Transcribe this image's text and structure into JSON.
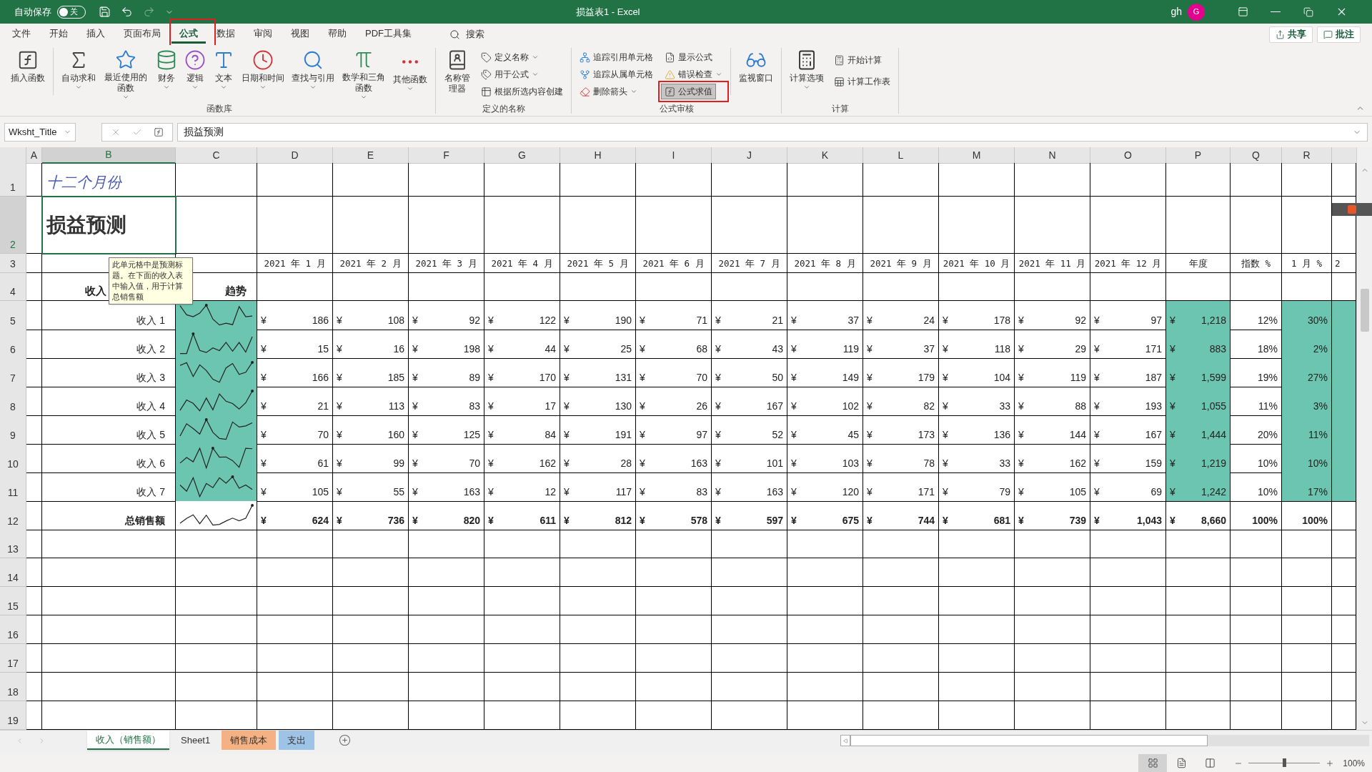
{
  "title_bar": {
    "autosave": {
      "label": "自动保存",
      "on": false,
      "state_label": "关"
    },
    "redo": {
      "disabled": true
    },
    "title": "损益表1 - Excel",
    "user": "gh",
    "avatar": "G"
  },
  "menu_tabs": [
    {
      "label": "文件",
      "selected": false,
      "annotated": false
    },
    {
      "label": "开始",
      "selected": false,
      "annotated": false
    },
    {
      "label": "插入",
      "selected": false,
      "annotated": false
    },
    {
      "label": "页面布局",
      "selected": false,
      "annotated": false
    },
    {
      "label": "公式",
      "selected": true,
      "annotated": true
    },
    {
      "label": "数据",
      "selected": false,
      "annotated": false
    },
    {
      "label": "审阅",
      "selected": false,
      "annotated": false
    },
    {
      "label": "视图",
      "selected": false,
      "annotated": false
    },
    {
      "label": "帮助",
      "selected": false,
      "annotated": false
    },
    {
      "label": "PDF工具集",
      "selected": false,
      "annotated": false
    }
  ],
  "search": {
    "label": "搜索"
  },
  "share_button": "共享",
  "comments_button": "批注",
  "ribbon": {
    "groups": [
      {
        "label": "函数库",
        "kind": "functions",
        "buttons": [
          {
            "label": "插入函数",
            "dropdown": false
          },
          {
            "label": "自动求和",
            "dropdown": true
          },
          {
            "label": "最近使用的函数",
            "dropdown": true
          },
          {
            "label": "财务",
            "dropdown": true
          },
          {
            "label": "逻辑",
            "dropdown": true
          },
          {
            "label": "文本",
            "dropdown": true
          },
          {
            "label": "日期和时间",
            "dropdown": true
          },
          {
            "label": "查找与引用",
            "dropdown": true
          },
          {
            "label": "数学和三角函数",
            "dropdown": true
          },
          {
            "label": "其他函数",
            "dropdown": true
          }
        ]
      },
      {
        "label": "定义的名称",
        "kind": "names",
        "large": {
          "label": "名称管理器",
          "dropdown": false
        },
        "small": [
          {
            "label": "定义名称",
            "dropdown": true
          },
          {
            "label": "用于公式",
            "dropdown": true
          },
          {
            "label": "根据所选内容创建",
            "dropdown": false
          }
        ]
      },
      {
        "label": "公式审核",
        "kind": "audit",
        "small": [
          {
            "label": "追踪引用单元格",
            "dropdown": false,
            "selected": false,
            "annotated": false
          },
          {
            "label": "追踪从属单元格",
            "dropdown": false,
            "selected": false,
            "annotated": false
          },
          {
            "label": "删除箭头",
            "dropdown": true,
            "selected": false,
            "annotated": false
          },
          {
            "label": "显示公式",
            "dropdown": false,
            "selected": false,
            "annotated": false
          },
          {
            "label": "错误检查",
            "dropdown": true,
            "selected": false,
            "annotated": false
          },
          {
            "label": "公式求值",
            "dropdown": false,
            "selected": true,
            "annotated": true
          }
        ],
        "large": {
          "label": "监视窗口",
          "dropdown": false
        }
      },
      {
        "label": "计算",
        "kind": "calc",
        "large": {
          "label": "计算选项",
          "dropdown": true
        },
        "small": [
          {
            "label": "开始计算",
            "dropdown": false
          },
          {
            "label": "计算工作表",
            "dropdown": false
          }
        ]
      }
    ]
  },
  "formula_bar": {
    "name_box": "Wksht_Title",
    "formula": "损益预测"
  },
  "sheet": {
    "columns": [
      {
        "label": "A",
        "selected": false
      },
      {
        "label": "B",
        "selected": true
      },
      {
        "label": "C",
        "selected": false
      },
      {
        "label": "D",
        "selected": false
      },
      {
        "label": "E",
        "selected": false
      },
      {
        "label": "F",
        "selected": false
      },
      {
        "label": "G",
        "selected": false
      },
      {
        "label": "H",
        "selected": false
      },
      {
        "label": "I",
        "selected": false
      },
      {
        "label": "J",
        "selected": false
      },
      {
        "label": "K",
        "selected": false
      },
      {
        "label": "L",
        "selected": false
      },
      {
        "label": "M",
        "selected": false
      },
      {
        "label": "N",
        "selected": false
      },
      {
        "label": "O",
        "selected": false
      },
      {
        "label": "P",
        "selected": false
      },
      {
        "label": "Q",
        "selected": false
      },
      {
        "label": "R",
        "selected": false
      }
    ],
    "row_numbers": [
      {
        "label": "1",
        "selected": false
      },
      {
        "label": "2",
        "selected": true
      },
      {
        "label": "3",
        "selected": false
      },
      {
        "label": "4",
        "selected": false
      },
      {
        "label": "5",
        "selected": false
      },
      {
        "label": "6",
        "selected": false
      },
      {
        "label": "7",
        "selected": false
      },
      {
        "label": "8",
        "selected": false
      },
      {
        "label": "9",
        "selected": false
      },
      {
        "label": "10",
        "selected": false
      },
      {
        "label": "11",
        "selected": false
      },
      {
        "label": "12",
        "selected": false
      },
      {
        "label": "13",
        "selected": false
      },
      {
        "label": "14",
        "selected": false
      },
      {
        "label": "15",
        "selected": false
      },
      {
        "label": "16",
        "selected": false
      },
      {
        "label": "17",
        "selected": false
      },
      {
        "label": "18",
        "selected": false
      },
      {
        "label": "19",
        "selected": false
      }
    ],
    "month_label": "十二个月份",
    "title_cell": {
      "text": "损益预测",
      "selected": true
    },
    "header_row": [
      "2021 年 1 月",
      "2021 年 2 月",
      "2021 年 3 月",
      "2021 年 4 月",
      "2021 年 5 月",
      "2021 年 6 月",
      "2021 年 7 月",
      "2021 年 8 月",
      "2021 年 9 月",
      "2021 年 10 月",
      "2021 年 11 月",
      "2021 年 12 月",
      "年度",
      "指数 %",
      "1 月 %",
      "2"
    ],
    "section_label": "收入",
    "trend_label": "趋势",
    "rows": [
      {
        "kind": "income",
        "label": "收入 1",
        "highlighted": true,
        "values": [
          {
            "symbol": "¥",
            "amount": "186"
          },
          {
            "symbol": "¥",
            "amount": "108"
          },
          {
            "symbol": "¥",
            "amount": "92"
          },
          {
            "symbol": "¥",
            "amount": "122"
          },
          {
            "symbol": "¥",
            "amount": "190"
          },
          {
            "symbol": "¥",
            "amount": "71"
          },
          {
            "symbol": "¥",
            "amount": "21"
          },
          {
            "symbol": "¥",
            "amount": "37"
          },
          {
            "symbol": "¥",
            "amount": "24"
          },
          {
            "symbol": "¥",
            "amount": "178"
          },
          {
            "symbol": "¥",
            "amount": "92"
          },
          {
            "symbol": "¥",
            "amount": "97"
          }
        ],
        "annual": {
          "symbol": "¥",
          "amount": "1,218"
        },
        "index": "12%",
        "share": "30%"
      },
      {
        "kind": "income",
        "label": "收入 2",
        "highlighted": true,
        "values": [
          {
            "symbol": "¥",
            "amount": "15"
          },
          {
            "symbol": "¥",
            "amount": "16"
          },
          {
            "symbol": "¥",
            "amount": "198"
          },
          {
            "symbol": "¥",
            "amount": "44"
          },
          {
            "symbol": "¥",
            "amount": "25"
          },
          {
            "symbol": "¥",
            "amount": "68"
          },
          {
            "symbol": "¥",
            "amount": "43"
          },
          {
            "symbol": "¥",
            "amount": "119"
          },
          {
            "symbol": "¥",
            "amount": "37"
          },
          {
            "symbol": "¥",
            "amount": "118"
          },
          {
            "symbol": "¥",
            "amount": "29"
          },
          {
            "symbol": "¥",
            "amount": "171"
          }
        ],
        "annual": {
          "symbol": "¥",
          "amount": "883"
        },
        "index": "18%",
        "share": "2%"
      },
      {
        "kind": "income",
        "label": "收入 3",
        "highlighted": true,
        "values": [
          {
            "symbol": "¥",
            "amount": "166"
          },
          {
            "symbol": "¥",
            "amount": "185"
          },
          {
            "symbol": "¥",
            "amount": "89"
          },
          {
            "symbol": "¥",
            "amount": "170"
          },
          {
            "symbol": "¥",
            "amount": "131"
          },
          {
            "symbol": "¥",
            "amount": "70"
          },
          {
            "symbol": "¥",
            "amount": "50"
          },
          {
            "symbol": "¥",
            "amount": "149"
          },
          {
            "symbol": "¥",
            "amount": "179"
          },
          {
            "symbol": "¥",
            "amount": "104"
          },
          {
            "symbol": "¥",
            "amount": "119"
          },
          {
            "symbol": "¥",
            "amount": "187"
          }
        ],
        "annual": {
          "symbol": "¥",
          "amount": "1,599"
        },
        "index": "19%",
        "share": "27%"
      },
      {
        "kind": "income",
        "label": "收入 4",
        "highlighted": true,
        "values": [
          {
            "symbol": "¥",
            "amount": "21"
          },
          {
            "symbol": "¥",
            "amount": "113"
          },
          {
            "symbol": "¥",
            "amount": "83"
          },
          {
            "symbol": "¥",
            "amount": "17"
          },
          {
            "symbol": "¥",
            "amount": "130"
          },
          {
            "symbol": "¥",
            "amount": "26"
          },
          {
            "symbol": "¥",
            "amount": "167"
          },
          {
            "symbol": "¥",
            "amount": "102"
          },
          {
            "symbol": "¥",
            "amount": "82"
          },
          {
            "symbol": "¥",
            "amount": "33"
          },
          {
            "symbol": "¥",
            "amount": "88"
          },
          {
            "symbol": "¥",
            "amount": "193"
          }
        ],
        "annual": {
          "symbol": "¥",
          "amount": "1,055"
        },
        "index": "11%",
        "share": "3%"
      },
      {
        "kind": "income",
        "label": "收入 5",
        "highlighted": true,
        "values": [
          {
            "symbol": "¥",
            "amount": "70"
          },
          {
            "symbol": "¥",
            "amount": "160"
          },
          {
            "symbol": "¥",
            "amount": "125"
          },
          {
            "symbol": "¥",
            "amount": "84"
          },
          {
            "symbol": "¥",
            "amount": "191"
          },
          {
            "symbol": "¥",
            "amount": "97"
          },
          {
            "symbol": "¥",
            "amount": "52"
          },
          {
            "symbol": "¥",
            "amount": "45"
          },
          {
            "symbol": "¥",
            "amount": "173"
          },
          {
            "symbol": "¥",
            "amount": "136"
          },
          {
            "symbol": "¥",
            "amount": "144"
          },
          {
            "symbol": "¥",
            "amount": "167"
          }
        ],
        "annual": {
          "symbol": "¥",
          "amount": "1,444"
        },
        "index": "20%",
        "share": "11%"
      },
      {
        "kind": "income",
        "label": "收入 6",
        "highlighted": true,
        "values": [
          {
            "symbol": "¥",
            "amount": "61"
          },
          {
            "symbol": "¥",
            "amount": "99"
          },
          {
            "symbol": "¥",
            "amount": "70"
          },
          {
            "symbol": "¥",
            "amount": "162"
          },
          {
            "symbol": "¥",
            "amount": "28"
          },
          {
            "symbol": "¥",
            "amount": "163"
          },
          {
            "symbol": "¥",
            "amount": "101"
          },
          {
            "symbol": "¥",
            "amount": "103"
          },
          {
            "symbol": "¥",
            "amount": "78"
          },
          {
            "symbol": "¥",
            "amount": "33"
          },
          {
            "symbol": "¥",
            "amount": "162"
          },
          {
            "symbol": "¥",
            "amount": "159"
          }
        ],
        "annual": {
          "symbol": "¥",
          "amount": "1,219"
        },
        "index": "10%",
        "share": "10%"
      },
      {
        "kind": "income",
        "label": "收入 7",
        "highlighted": true,
        "values": [
          {
            "symbol": "¥",
            "amount": "105"
          },
          {
            "symbol": "¥",
            "amount": "55"
          },
          {
            "symbol": "¥",
            "amount": "163"
          },
          {
            "symbol": "¥",
            "amount": "12"
          },
          {
            "symbol": "¥",
            "amount": "117"
          },
          {
            "symbol": "¥",
            "amount": "83"
          },
          {
            "symbol": "¥",
            "amount": "163"
          },
          {
            "symbol": "¥",
            "amount": "120"
          },
          {
            "symbol": "¥",
            "amount": "171"
          },
          {
            "symbol": "¥",
            "amount": "79"
          },
          {
            "symbol": "¥",
            "amount": "105"
          },
          {
            "symbol": "¥",
            "amount": "69"
          }
        ],
        "annual": {
          "symbol": "¥",
          "amount": "1,242"
        },
        "index": "10%",
        "share": "17%"
      },
      {
        "kind": "total",
        "label": "总销售额",
        "highlighted": false,
        "values": [
          {
            "symbol": "¥",
            "amount": "624"
          },
          {
            "symbol": "¥",
            "amount": "736"
          },
          {
            "symbol": "¥",
            "amount": "820"
          },
          {
            "symbol": "¥",
            "amount": "611"
          },
          {
            "symbol": "¥",
            "amount": "812"
          },
          {
            "symbol": "¥",
            "amount": "578"
          },
          {
            "symbol": "¥",
            "amount": "597"
          },
          {
            "symbol": "¥",
            "amount": "675"
          },
          {
            "symbol": "¥",
            "amount": "744"
          },
          {
            "symbol": "¥",
            "amount": "681"
          },
          {
            "symbol": "¥",
            "amount": "739"
          },
          {
            "symbol": "¥",
            "amount": "1,043"
          }
        ],
        "annual": {
          "symbol": "¥",
          "amount": "8,660"
        },
        "index": "100%",
        "share": "100%"
      }
    ]
  },
  "comment": "此单元格中是预测标题。在下面的收入表中输入值，用于计算总销售额",
  "sheet_tabs": [
    {
      "label": "收入（销售额）",
      "selected": true
    },
    {
      "label": "Sheet1",
      "selected": false
    },
    {
      "label": "销售成本",
      "selected": false,
      "color": "#f4b183"
    },
    {
      "label": "支出",
      "selected": false,
      "color": "#9dc3e6"
    }
  ],
  "status_bar": {
    "views": [
      {
        "selected": true
      },
      {
        "selected": false
      },
      {
        "selected": false
      }
    ],
    "zoom": {
      "level": 0.5,
      "label": "100%"
    }
  }
}
